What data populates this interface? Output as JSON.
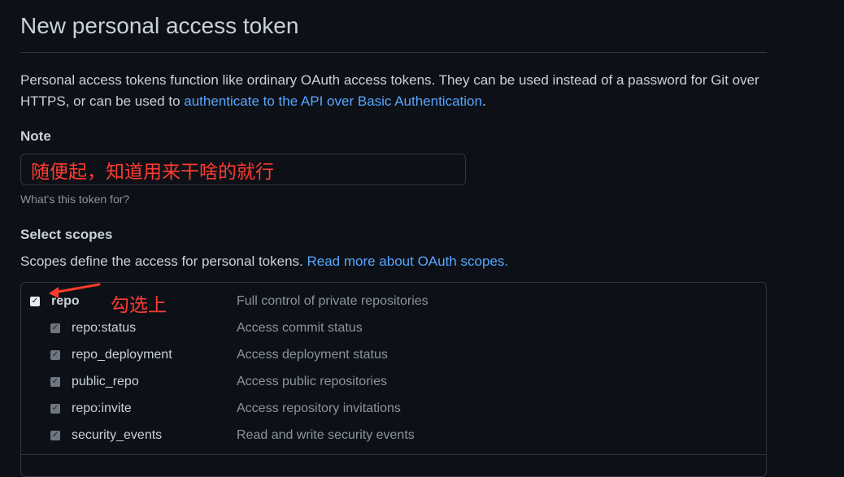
{
  "header": {
    "title": "New personal access token"
  },
  "intro": {
    "text_before": "Personal access tokens function like ordinary OAuth access tokens. They can be used instead of a password for Git over HTTPS, or can be used to ",
    "link_text": "authenticate to the API over Basic Authentication",
    "text_after": "."
  },
  "note": {
    "label": "Note",
    "value": "随便起，知道用来干啥的就行",
    "hint": "What's this token for?"
  },
  "scopes": {
    "label": "Select scopes",
    "description": "Scopes define the access for personal tokens. ",
    "link_text": "Read more about OAuth scopes.",
    "annotation": "勾选上",
    "items": [
      {
        "name": "repo",
        "description": "Full control of private repositories",
        "checked": true
      },
      {
        "name": "repo:status",
        "description": "Access commit status",
        "checked": true
      },
      {
        "name": "repo_deployment",
        "description": "Access deployment status",
        "checked": true
      },
      {
        "name": "public_repo",
        "description": "Access public repositories",
        "checked": true
      },
      {
        "name": "repo:invite",
        "description": "Access repository invitations",
        "checked": true
      },
      {
        "name": "security_events",
        "description": "Read and write security events",
        "checked": true
      }
    ]
  },
  "colors": {
    "background": "#0d1117",
    "text": "#c9d1d9",
    "muted": "#8b949e",
    "link": "#58a6ff",
    "border": "#30363d",
    "annotation": "#ff3b30"
  }
}
